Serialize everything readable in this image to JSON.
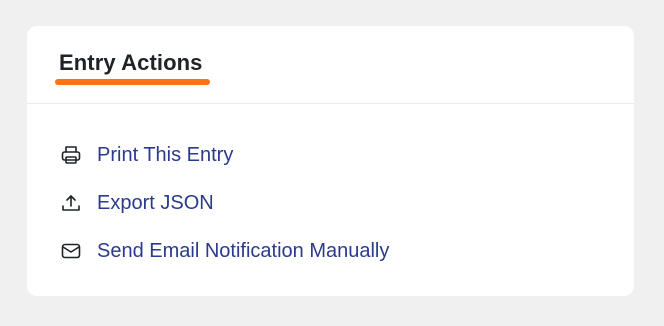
{
  "panel": {
    "title": "Entry Actions",
    "accent_color": "#f97316",
    "link_color": "#2b3a8c"
  },
  "actions": [
    {
      "label": "Print This Entry",
      "icon": "printer-icon"
    },
    {
      "label": "Export JSON",
      "icon": "upload-icon"
    },
    {
      "label": "Send Email Notification Manually",
      "icon": "mail-icon"
    }
  ]
}
